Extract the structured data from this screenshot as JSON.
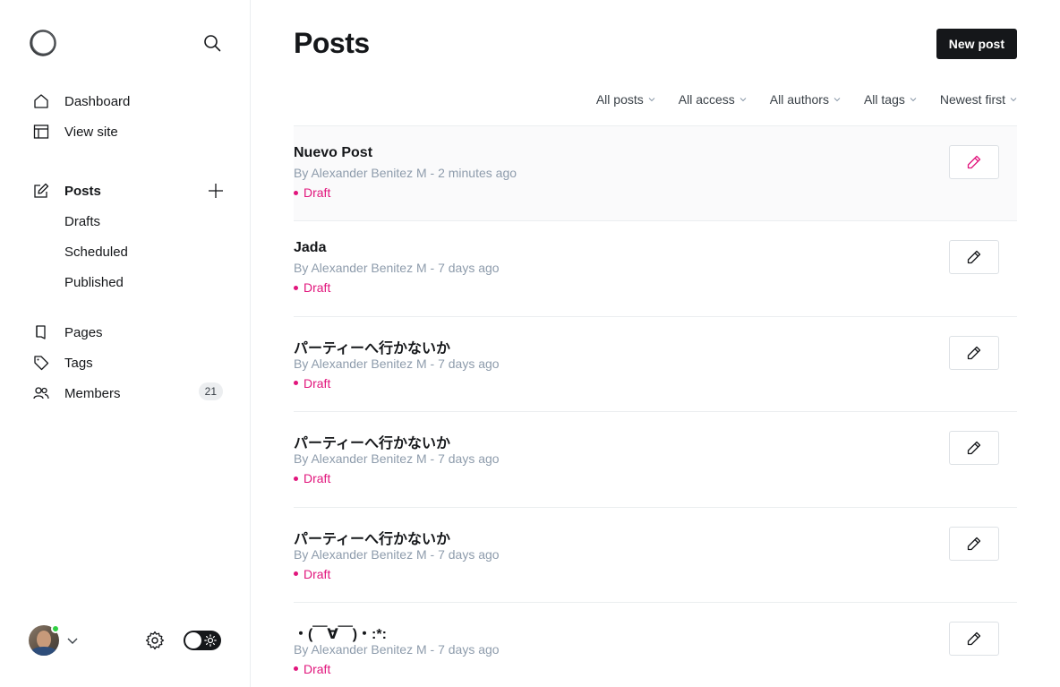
{
  "sidebar": {
    "nav_top": [
      {
        "label": "Dashboard",
        "icon": "home-icon"
      },
      {
        "label": "View site",
        "icon": "layout-icon"
      }
    ],
    "posts": {
      "label": "Posts",
      "icon": "edit-icon"
    },
    "posts_sub": [
      {
        "label": "Drafts"
      },
      {
        "label": "Scheduled"
      },
      {
        "label": "Published"
      }
    ],
    "nav_bottom": [
      {
        "label": "Pages",
        "icon": "page-icon"
      },
      {
        "label": "Tags",
        "icon": "tag-icon"
      },
      {
        "label": "Members",
        "icon": "members-icon",
        "count": "21"
      }
    ]
  },
  "header": {
    "title": "Posts",
    "new_post_label": "New post"
  },
  "filters": [
    "All posts",
    "All access",
    "All authors",
    "All tags",
    "Newest first"
  ],
  "posts": [
    {
      "title": "Nuevo Post",
      "meta": "By Alexander Benitez M - 2 minutes ago",
      "status": "Draft"
    },
    {
      "title": "Jada",
      "meta": "By Alexander Benitez M - 7 days ago",
      "status": "Draft"
    },
    {
      "title": "パーティーへ行かないか",
      "meta": "By Alexander Benitez M - 7 days ago",
      "status": "Draft"
    },
    {
      "title": "パーティーへ行かないか",
      "meta": "By Alexander Benitez M - 7 days ago",
      "status": "Draft"
    },
    {
      "title": "パーティーへ行かないか",
      "meta": "By Alexander Benitez M - 7 days ago",
      "status": "Draft"
    },
    {
      "title": "・(￣∀￣)・:*:",
      "meta": "By Alexander Benitez M - 7 days ago",
      "status": "Draft"
    }
  ],
  "colors": {
    "accent": "#e1157c",
    "dark": "#15171a",
    "muted": "#8e9cac",
    "online": "#30cf43"
  }
}
